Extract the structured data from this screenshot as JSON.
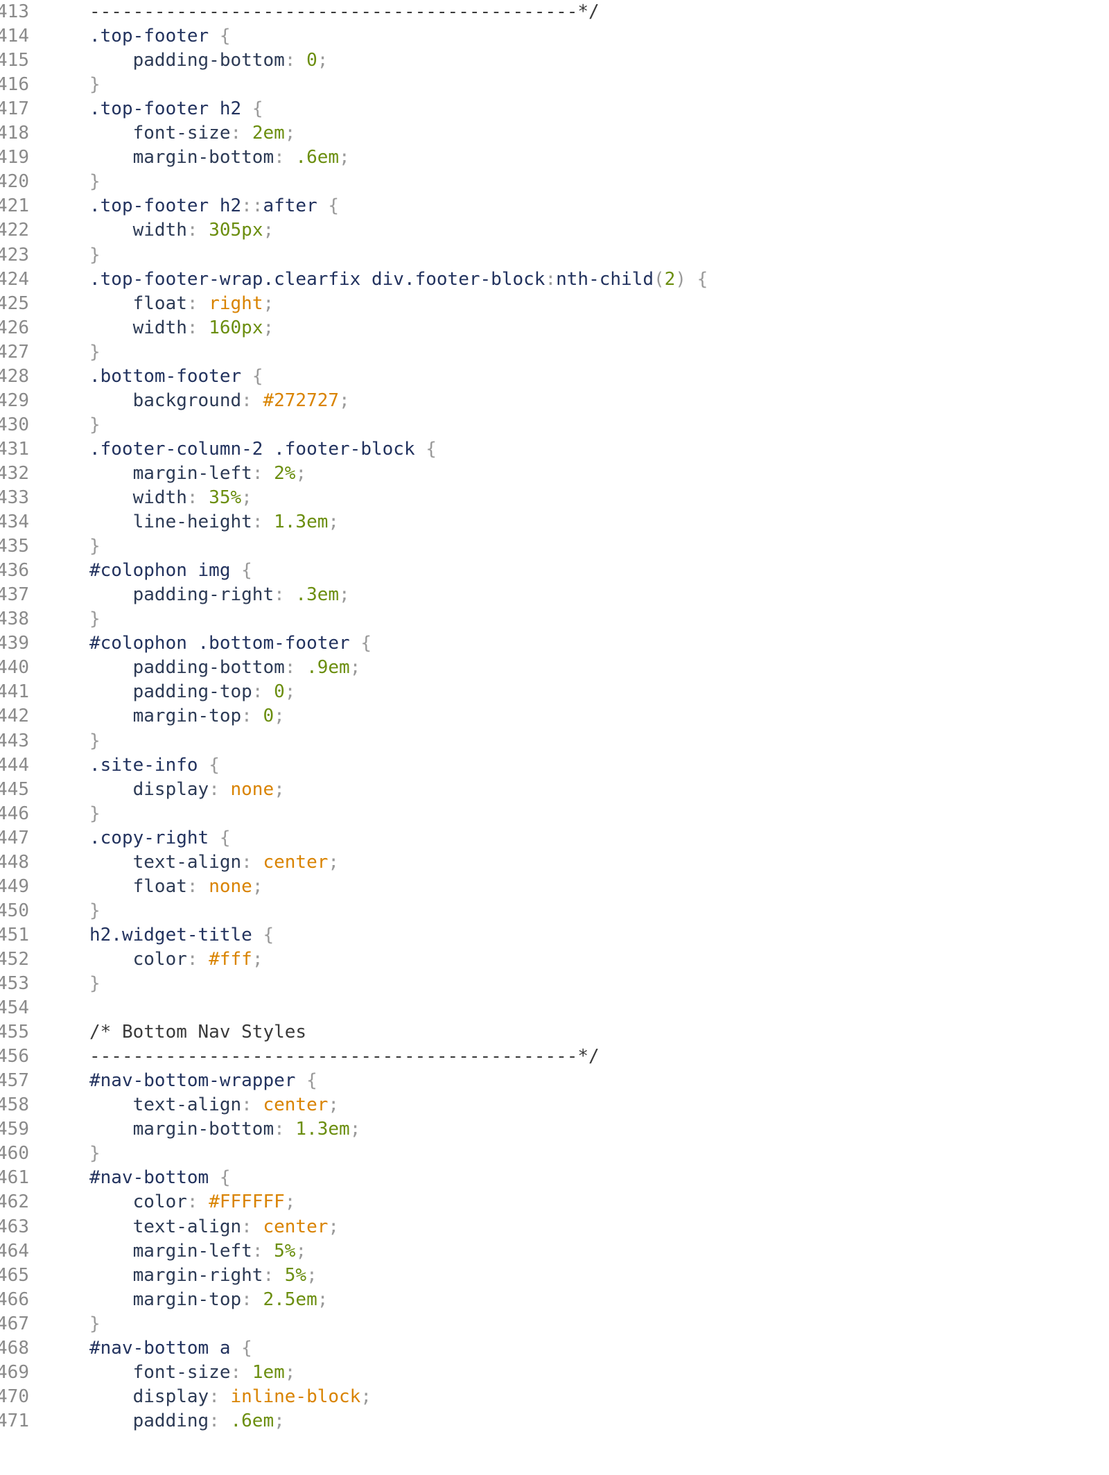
{
  "colors": {
    "selector": "#22325e",
    "punctuation": "#9a9a9a",
    "property": "#2c3a55",
    "number": "#6b8e0f",
    "keyword": "#d98300",
    "comment": "#3a3a3a",
    "line_number": "#8a8a8a",
    "background": "#ffffff"
  },
  "lines": [
    {
      "n": "413",
      "tokens": [
        {
          "t": "---------------------------------------------*/",
          "c": "cmt"
        }
      ]
    },
    {
      "n": "414",
      "tokens": [
        {
          "t": ".top-footer ",
          "c": "sel"
        },
        {
          "t": "{",
          "c": "punct"
        }
      ]
    },
    {
      "n": "415",
      "tokens": [
        {
          "t": "    padding-bottom",
          "c": "prop"
        },
        {
          "t": ": ",
          "c": "punct"
        },
        {
          "t": "0",
          "c": "num"
        },
        {
          "t": ";",
          "c": "punct"
        }
      ]
    },
    {
      "n": "416",
      "tokens": [
        {
          "t": "}",
          "c": "punct"
        }
      ]
    },
    {
      "n": "417",
      "tokens": [
        {
          "t": ".top-footer h2 ",
          "c": "sel"
        },
        {
          "t": "{",
          "c": "punct"
        }
      ]
    },
    {
      "n": "418",
      "tokens": [
        {
          "t": "    font-size",
          "c": "prop"
        },
        {
          "t": ": ",
          "c": "punct"
        },
        {
          "t": "2em",
          "c": "num"
        },
        {
          "t": ";",
          "c": "punct"
        }
      ]
    },
    {
      "n": "419",
      "tokens": [
        {
          "t": "    margin-bottom",
          "c": "prop"
        },
        {
          "t": ": ",
          "c": "punct"
        },
        {
          "t": ".6em",
          "c": "num"
        },
        {
          "t": ";",
          "c": "punct"
        }
      ]
    },
    {
      "n": "420",
      "tokens": [
        {
          "t": "}",
          "c": "punct"
        }
      ]
    },
    {
      "n": "421",
      "tokens": [
        {
          "t": ".top-footer h2",
          "c": "sel"
        },
        {
          "t": "::",
          "c": "punct"
        },
        {
          "t": "after ",
          "c": "sel"
        },
        {
          "t": "{",
          "c": "punct"
        }
      ]
    },
    {
      "n": "422",
      "tokens": [
        {
          "t": "    width",
          "c": "prop"
        },
        {
          "t": ": ",
          "c": "punct"
        },
        {
          "t": "305px",
          "c": "num"
        },
        {
          "t": ";",
          "c": "punct"
        }
      ]
    },
    {
      "n": "423",
      "tokens": [
        {
          "t": "}",
          "c": "punct"
        }
      ]
    },
    {
      "n": "424",
      "tokens": [
        {
          "t": ".top-footer-wrap.clearfix div.footer-block",
          "c": "sel"
        },
        {
          "t": ":",
          "c": "punct"
        },
        {
          "t": "nth-child",
          "c": "sel"
        },
        {
          "t": "(",
          "c": "punct"
        },
        {
          "t": "2",
          "c": "num"
        },
        {
          "t": ") {",
          "c": "punct"
        }
      ]
    },
    {
      "n": "425",
      "tokens": [
        {
          "t": "    float",
          "c": "prop"
        },
        {
          "t": ": ",
          "c": "punct"
        },
        {
          "t": "right",
          "c": "kw"
        },
        {
          "t": ";",
          "c": "punct"
        }
      ]
    },
    {
      "n": "426",
      "tokens": [
        {
          "t": "    width",
          "c": "prop"
        },
        {
          "t": ": ",
          "c": "punct"
        },
        {
          "t": "160px",
          "c": "num"
        },
        {
          "t": ";",
          "c": "punct"
        }
      ]
    },
    {
      "n": "427",
      "tokens": [
        {
          "t": "}",
          "c": "punct"
        }
      ]
    },
    {
      "n": "428",
      "tokens": [
        {
          "t": ".bottom-footer ",
          "c": "sel"
        },
        {
          "t": "{",
          "c": "punct"
        }
      ]
    },
    {
      "n": "429",
      "tokens": [
        {
          "t": "    background",
          "c": "prop"
        },
        {
          "t": ": ",
          "c": "punct"
        },
        {
          "t": "#272727",
          "c": "kw"
        },
        {
          "t": ";",
          "c": "punct"
        }
      ]
    },
    {
      "n": "430",
      "tokens": [
        {
          "t": "}",
          "c": "punct"
        }
      ]
    },
    {
      "n": "431",
      "tokens": [
        {
          "t": ".footer-column-2 .footer-block ",
          "c": "sel"
        },
        {
          "t": "{",
          "c": "punct"
        }
      ]
    },
    {
      "n": "432",
      "tokens": [
        {
          "t": "    margin-left",
          "c": "prop"
        },
        {
          "t": ": ",
          "c": "punct"
        },
        {
          "t": "2%",
          "c": "num"
        },
        {
          "t": ";",
          "c": "punct"
        }
      ]
    },
    {
      "n": "433",
      "tokens": [
        {
          "t": "    width",
          "c": "prop"
        },
        {
          "t": ": ",
          "c": "punct"
        },
        {
          "t": "35%",
          "c": "num"
        },
        {
          "t": ";",
          "c": "punct"
        }
      ]
    },
    {
      "n": "434",
      "tokens": [
        {
          "t": "    line-height",
          "c": "prop"
        },
        {
          "t": ": ",
          "c": "punct"
        },
        {
          "t": "1.3em",
          "c": "num"
        },
        {
          "t": ";",
          "c": "punct"
        }
      ]
    },
    {
      "n": "435",
      "tokens": [
        {
          "t": "}",
          "c": "punct"
        }
      ]
    },
    {
      "n": "436",
      "tokens": [
        {
          "t": "#colophon img ",
          "c": "sel"
        },
        {
          "t": "{",
          "c": "punct"
        }
      ]
    },
    {
      "n": "437",
      "tokens": [
        {
          "t": "    padding-right",
          "c": "prop"
        },
        {
          "t": ": ",
          "c": "punct"
        },
        {
          "t": ".3em",
          "c": "num"
        },
        {
          "t": ";",
          "c": "punct"
        }
      ]
    },
    {
      "n": "438",
      "tokens": [
        {
          "t": "}",
          "c": "punct"
        }
      ]
    },
    {
      "n": "439",
      "tokens": [
        {
          "t": "#colophon .bottom-footer ",
          "c": "sel"
        },
        {
          "t": "{",
          "c": "punct"
        }
      ]
    },
    {
      "n": "440",
      "tokens": [
        {
          "t": "    padding-bottom",
          "c": "prop"
        },
        {
          "t": ": ",
          "c": "punct"
        },
        {
          "t": ".9em",
          "c": "num"
        },
        {
          "t": ";",
          "c": "punct"
        }
      ]
    },
    {
      "n": "441",
      "tokens": [
        {
          "t": "    padding-top",
          "c": "prop"
        },
        {
          "t": ": ",
          "c": "punct"
        },
        {
          "t": "0",
          "c": "num"
        },
        {
          "t": ";",
          "c": "punct"
        }
      ]
    },
    {
      "n": "442",
      "tokens": [
        {
          "t": "    margin-top",
          "c": "prop"
        },
        {
          "t": ": ",
          "c": "punct"
        },
        {
          "t": "0",
          "c": "num"
        },
        {
          "t": ";",
          "c": "punct"
        }
      ]
    },
    {
      "n": "443",
      "tokens": [
        {
          "t": "}",
          "c": "punct"
        }
      ]
    },
    {
      "n": "444",
      "tokens": [
        {
          "t": ".site-info ",
          "c": "sel"
        },
        {
          "t": "{",
          "c": "punct"
        }
      ]
    },
    {
      "n": "445",
      "tokens": [
        {
          "t": "    display",
          "c": "prop"
        },
        {
          "t": ": ",
          "c": "punct"
        },
        {
          "t": "none",
          "c": "kw"
        },
        {
          "t": ";",
          "c": "punct"
        }
      ]
    },
    {
      "n": "446",
      "tokens": [
        {
          "t": "}",
          "c": "punct"
        }
      ]
    },
    {
      "n": "447",
      "tokens": [
        {
          "t": ".copy-right ",
          "c": "sel"
        },
        {
          "t": "{",
          "c": "punct"
        }
      ]
    },
    {
      "n": "448",
      "tokens": [
        {
          "t": "    text-align",
          "c": "prop"
        },
        {
          "t": ": ",
          "c": "punct"
        },
        {
          "t": "center",
          "c": "kw"
        },
        {
          "t": ";",
          "c": "punct"
        }
      ]
    },
    {
      "n": "449",
      "tokens": [
        {
          "t": "    float",
          "c": "prop"
        },
        {
          "t": ": ",
          "c": "punct"
        },
        {
          "t": "none",
          "c": "kw"
        },
        {
          "t": ";",
          "c": "punct"
        }
      ]
    },
    {
      "n": "450",
      "tokens": [
        {
          "t": "}",
          "c": "punct"
        }
      ]
    },
    {
      "n": "451",
      "tokens": [
        {
          "t": "h2.widget-title ",
          "c": "sel"
        },
        {
          "t": "{",
          "c": "punct"
        }
      ]
    },
    {
      "n": "452",
      "tokens": [
        {
          "t": "    color",
          "c": "prop"
        },
        {
          "t": ": ",
          "c": "punct"
        },
        {
          "t": "#fff",
          "c": "kw"
        },
        {
          "t": ";",
          "c": "punct"
        }
      ]
    },
    {
      "n": "453",
      "tokens": [
        {
          "t": "}",
          "c": "punct"
        }
      ]
    },
    {
      "n": "454",
      "tokens": []
    },
    {
      "n": "455",
      "tokens": [
        {
          "t": "/* Bottom Nav Styles",
          "c": "cmt"
        }
      ]
    },
    {
      "n": "456",
      "tokens": [
        {
          "t": "---------------------------------------------*/",
          "c": "cmt"
        }
      ]
    },
    {
      "n": "457",
      "tokens": [
        {
          "t": "#nav-bottom-wrapper ",
          "c": "sel"
        },
        {
          "t": "{",
          "c": "punct"
        }
      ]
    },
    {
      "n": "458",
      "tokens": [
        {
          "t": "    text-align",
          "c": "prop"
        },
        {
          "t": ": ",
          "c": "punct"
        },
        {
          "t": "center",
          "c": "kw"
        },
        {
          "t": ";",
          "c": "punct"
        }
      ]
    },
    {
      "n": "459",
      "tokens": [
        {
          "t": "    margin-bottom",
          "c": "prop"
        },
        {
          "t": ": ",
          "c": "punct"
        },
        {
          "t": "1.3em",
          "c": "num"
        },
        {
          "t": ";",
          "c": "punct"
        }
      ]
    },
    {
      "n": "460",
      "tokens": [
        {
          "t": "}",
          "c": "punct"
        }
      ]
    },
    {
      "n": "461",
      "tokens": [
        {
          "t": "#nav-bottom ",
          "c": "sel"
        },
        {
          "t": "{",
          "c": "punct"
        }
      ]
    },
    {
      "n": "462",
      "tokens": [
        {
          "t": "    color",
          "c": "prop"
        },
        {
          "t": ": ",
          "c": "punct"
        },
        {
          "t": "#FFFFFF",
          "c": "kw"
        },
        {
          "t": ";",
          "c": "punct"
        }
      ]
    },
    {
      "n": "463",
      "tokens": [
        {
          "t": "    text-align",
          "c": "prop"
        },
        {
          "t": ": ",
          "c": "punct"
        },
        {
          "t": "center",
          "c": "kw"
        },
        {
          "t": ";",
          "c": "punct"
        }
      ]
    },
    {
      "n": "464",
      "tokens": [
        {
          "t": "    margin-left",
          "c": "prop"
        },
        {
          "t": ": ",
          "c": "punct"
        },
        {
          "t": "5%",
          "c": "num"
        },
        {
          "t": ";",
          "c": "punct"
        }
      ]
    },
    {
      "n": "465",
      "tokens": [
        {
          "t": "    margin-right",
          "c": "prop"
        },
        {
          "t": ": ",
          "c": "punct"
        },
        {
          "t": "5%",
          "c": "num"
        },
        {
          "t": ";",
          "c": "punct"
        }
      ]
    },
    {
      "n": "466",
      "tokens": [
        {
          "t": "    margin-top",
          "c": "prop"
        },
        {
          "t": ": ",
          "c": "punct"
        },
        {
          "t": "2.5em",
          "c": "num"
        },
        {
          "t": ";",
          "c": "punct"
        }
      ]
    },
    {
      "n": "467",
      "tokens": [
        {
          "t": "}",
          "c": "punct"
        }
      ]
    },
    {
      "n": "468",
      "tokens": [
        {
          "t": "#nav-bottom a ",
          "c": "sel"
        },
        {
          "t": "{",
          "c": "punct"
        }
      ]
    },
    {
      "n": "469",
      "tokens": [
        {
          "t": "    font-size",
          "c": "prop"
        },
        {
          "t": ": ",
          "c": "punct"
        },
        {
          "t": "1em",
          "c": "num"
        },
        {
          "t": ";",
          "c": "punct"
        }
      ]
    },
    {
      "n": "470",
      "tokens": [
        {
          "t": "    display",
          "c": "prop"
        },
        {
          "t": ": ",
          "c": "punct"
        },
        {
          "t": "inline-block",
          "c": "kw"
        },
        {
          "t": ";",
          "c": "punct"
        }
      ]
    },
    {
      "n": "471",
      "tokens": [
        {
          "t": "    padding",
          "c": "prop"
        },
        {
          "t": ": ",
          "c": "punct"
        },
        {
          "t": ".6em",
          "c": "num"
        },
        {
          "t": ";",
          "c": "punct"
        }
      ]
    }
  ]
}
